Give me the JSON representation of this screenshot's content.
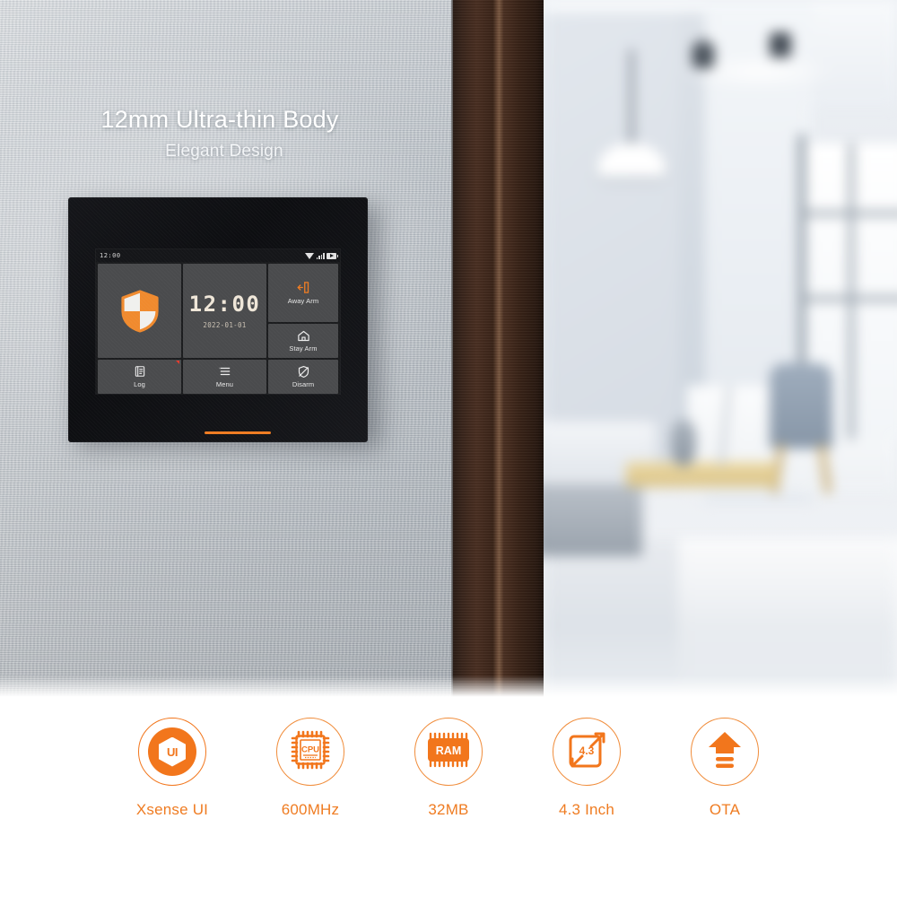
{
  "hero": {
    "headline": "12mm Ultra-thin Body",
    "subheadline": "Elegant Design"
  },
  "device": {
    "screen": {
      "status_bar": {
        "time": "12:00",
        "icons": [
          "wifi-icon",
          "cellular-signal-icon",
          "battery-icon"
        ]
      },
      "tiles": {
        "shield": {
          "icon": "shield-checkered-icon",
          "label": ""
        },
        "clock": {
          "time": "12:00",
          "date": "2022-01-01"
        },
        "away_arm": {
          "icon": "exit-door-arrow-icon",
          "label": "Away Arm"
        },
        "stay_arm": {
          "icon": "house-icon",
          "label": "Stay Arm"
        },
        "disarm": {
          "icon": "shield-slash-icon",
          "label": "Disarm"
        },
        "log": {
          "icon": "document-list-icon",
          "label": "Log",
          "badge": true
        },
        "menu": {
          "icon": "hamburger-list-icon",
          "label": "Menu"
        }
      }
    }
  },
  "features": [
    {
      "icon": "ui-hexagon-icon",
      "badge_text": "UI",
      "label": "Xsense UI"
    },
    {
      "icon": "cpu-chip-icon",
      "badge_text": "CPU",
      "label": "600MHz"
    },
    {
      "icon": "ram-chip-icon",
      "badge_text": "RAM",
      "label": "32MB"
    },
    {
      "icon": "screen-diagonal-icon",
      "badge_text": "4.3",
      "label": "4.3 Inch"
    },
    {
      "icon": "ota-upload-icon",
      "badge_text": "",
      "label": "OTA"
    }
  ],
  "colors": {
    "accent_orange": "#ef7c22",
    "icon_orange": "#f2761c",
    "badge_red": "#e23b2e",
    "screen_tile": "#4a4b4d",
    "screen_bg": "#1b1c1e"
  }
}
